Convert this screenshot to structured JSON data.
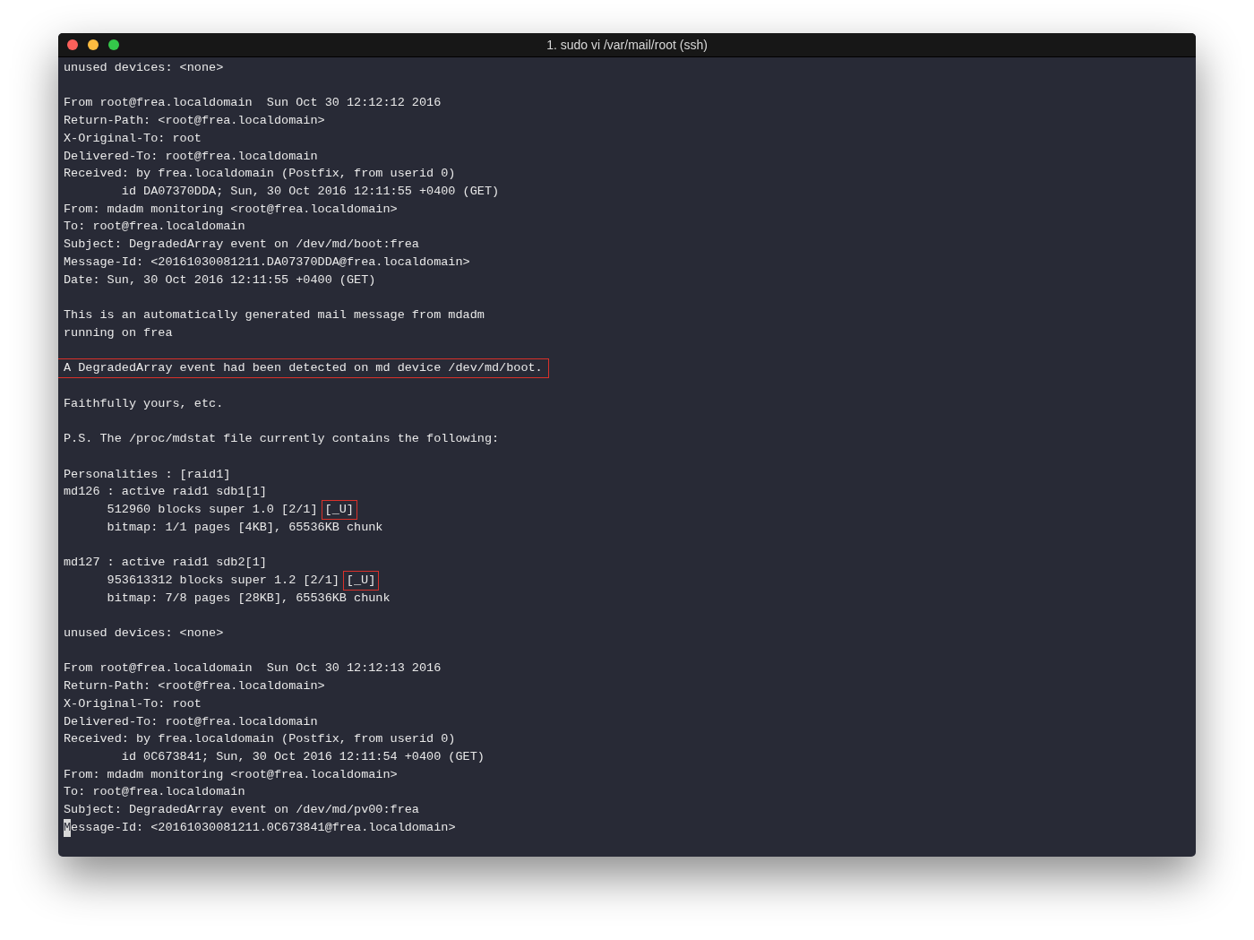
{
  "window": {
    "title": "1. sudo vi /var/mail/root (ssh)",
    "buttons": [
      {
        "color": "#fc605b"
      },
      {
        "color": "#fdbc40"
      },
      {
        "color": "#34c84a"
      }
    ]
  },
  "lines": [
    {
      "kind": "text",
      "segments": [
        {
          "text": "unused devices: <none>"
        }
      ]
    },
    {
      "kind": "blank"
    },
    {
      "kind": "text",
      "segments": [
        {
          "text": "From root@frea.localdomain  Sun Oct 30 12:12:12 2016"
        }
      ]
    },
    {
      "kind": "text",
      "segments": [
        {
          "text": "Return-Path: <root@frea.localdomain>"
        }
      ]
    },
    {
      "kind": "text",
      "segments": [
        {
          "text": "X-Original-To: root"
        }
      ]
    },
    {
      "kind": "text",
      "segments": [
        {
          "text": "Delivered-To: root@frea.localdomain"
        }
      ]
    },
    {
      "kind": "text",
      "segments": [
        {
          "text": "Received: by frea.localdomain (Postfix, from userid 0)"
        }
      ]
    },
    {
      "kind": "text",
      "segments": [
        {
          "text": "        id DA07370DDA; Sun, 30 Oct 2016 12:11:55 +0400 (GET)"
        }
      ]
    },
    {
      "kind": "text",
      "segments": [
        {
          "text": "From: mdadm monitoring <root@frea.localdomain>"
        }
      ]
    },
    {
      "kind": "text",
      "segments": [
        {
          "text": "To: root@frea.localdomain"
        }
      ]
    },
    {
      "kind": "text",
      "segments": [
        {
          "text": "Subject: DegradedArray event on /dev/md/boot:frea"
        }
      ]
    },
    {
      "kind": "text",
      "segments": [
        {
          "text": "Message-Id: <20161030081211.DA07370DDA@frea.localdomain>"
        }
      ]
    },
    {
      "kind": "text",
      "segments": [
        {
          "text": "Date: Sun, 30 Oct 2016 12:11:55 +0400 (GET)"
        }
      ]
    },
    {
      "kind": "blank"
    },
    {
      "kind": "text",
      "segments": [
        {
          "text": "This is an automatically generated mail message from mdadm"
        }
      ]
    },
    {
      "kind": "text",
      "segments": [
        {
          "text": "running on frea"
        }
      ]
    },
    {
      "kind": "blank"
    },
    {
      "kind": "text",
      "segments": [
        {
          "text": "A DegradedArray event had been detected on md device /dev/md/boot.",
          "boxed": true
        }
      ]
    },
    {
      "kind": "blank"
    },
    {
      "kind": "text",
      "segments": [
        {
          "text": "Faithfully yours, etc."
        }
      ]
    },
    {
      "kind": "blank"
    },
    {
      "kind": "text",
      "segments": [
        {
          "text": "P.S. The /proc/mdstat file currently contains the following:"
        }
      ]
    },
    {
      "kind": "blank"
    },
    {
      "kind": "text",
      "segments": [
        {
          "text": "Personalities : [raid1]"
        }
      ]
    },
    {
      "kind": "text",
      "segments": [
        {
          "text": "md126 : active raid1 sdb1[1]"
        }
      ]
    },
    {
      "kind": "text",
      "segments": [
        {
          "text": "      512960 blocks super 1.0 [2/1]"
        },
        {
          "text": "[_U]",
          "boxed": true
        }
      ]
    },
    {
      "kind": "text",
      "segments": [
        {
          "text": "      bitmap: 1/1 pages [4KB], 65536KB chunk"
        }
      ]
    },
    {
      "kind": "blank"
    },
    {
      "kind": "text",
      "segments": [
        {
          "text": "md127 : active raid1 sdb2[1]"
        }
      ]
    },
    {
      "kind": "text",
      "segments": [
        {
          "text": "      953613312 blocks super 1.2 [2/1]"
        },
        {
          "text": "[_U]",
          "boxed": true
        }
      ]
    },
    {
      "kind": "text",
      "segments": [
        {
          "text": "      bitmap: 7/8 pages [28KB], 65536KB chunk"
        }
      ]
    },
    {
      "kind": "blank"
    },
    {
      "kind": "text",
      "segments": [
        {
          "text": "unused devices: <none>"
        }
      ]
    },
    {
      "kind": "blank"
    },
    {
      "kind": "text",
      "segments": [
        {
          "text": "From root@frea.localdomain  Sun Oct 30 12:12:13 2016"
        }
      ]
    },
    {
      "kind": "text",
      "segments": [
        {
          "text": "Return-Path: <root@frea.localdomain>"
        }
      ]
    },
    {
      "kind": "text",
      "segments": [
        {
          "text": "X-Original-To: root"
        }
      ]
    },
    {
      "kind": "text",
      "segments": [
        {
          "text": "Delivered-To: root@frea.localdomain"
        }
      ]
    },
    {
      "kind": "text",
      "segments": [
        {
          "text": "Received: by frea.localdomain (Postfix, from userid 0)"
        }
      ]
    },
    {
      "kind": "text",
      "segments": [
        {
          "text": "        id 0C673841; Sun, 30 Oct 2016 12:11:54 +0400 (GET)"
        }
      ]
    },
    {
      "kind": "text",
      "segments": [
        {
          "text": "From: mdadm monitoring <root@frea.localdomain>"
        }
      ]
    },
    {
      "kind": "text",
      "segments": [
        {
          "text": "To: root@frea.localdomain"
        }
      ]
    },
    {
      "kind": "text",
      "segments": [
        {
          "text": "Subject: DegradedArray event on /dev/md/pv00:frea"
        }
      ]
    },
    {
      "kind": "text",
      "segments": [
        {
          "text": "M",
          "cursor": true
        },
        {
          "text": "essage-Id: <20161030081211.0C673841@frea.localdomain>"
        }
      ]
    }
  ]
}
